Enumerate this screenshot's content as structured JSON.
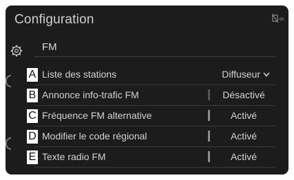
{
  "screen": {
    "title": "Configuration",
    "section_label": "FM"
  },
  "settings": [
    {
      "callout": "A",
      "label": "Liste des stations",
      "value": "Diffuseur",
      "has_dropdown": true
    },
    {
      "callout": "B",
      "label": "Annonce info-trafic FM",
      "value": "Désactivé"
    },
    {
      "callout": "C",
      "label": "Fréquence FM alternative",
      "value": "Activé"
    },
    {
      "callout": "D",
      "label": "Modifier le code régional",
      "value": "Activé"
    },
    {
      "callout": "E",
      "label": "Texte radio FM",
      "value": "Activé"
    }
  ],
  "icons": [
    "gear-icon",
    "signal-status-icon",
    "chevron-down-icon"
  ],
  "colors": {
    "background": "#1c1c1c",
    "text": "#d2d2d2",
    "callout_bg": "#ffffff"
  }
}
